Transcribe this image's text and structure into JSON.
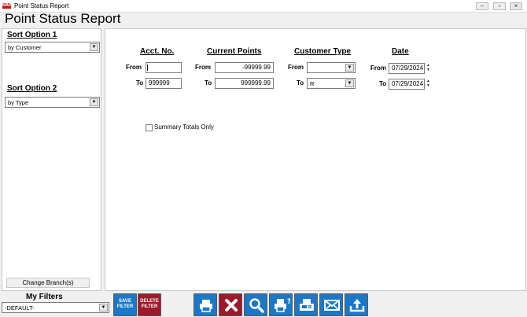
{
  "window": {
    "title": "Point Status Report",
    "app_icon_text": "HAP",
    "controls": [
      "minimize",
      "restore",
      "close"
    ]
  },
  "report": {
    "title": "Point Status Report"
  },
  "sort": {
    "option1_label": "Sort Option 1",
    "option1_value": "by Customer",
    "option2_label": "Sort Option 2",
    "option2_value": "by Type",
    "change_branch_label": "Change Branch(s)"
  },
  "criteria": {
    "acct": {
      "heading": "Acct. No.",
      "from_label": "From",
      "to_label": "To",
      "from_value": "",
      "to_value": "999999"
    },
    "points": {
      "heading": "Current Points",
      "from_label": "From",
      "to_label": "To",
      "from_value": "-99999.99",
      "to_value": "999999.99"
    },
    "customer_type": {
      "heading": "Customer Type",
      "from_label": "From",
      "to_label": "To",
      "from_value": "",
      "to_value": "R"
    },
    "date": {
      "heading": "Date",
      "from_label": "From",
      "to_label": "To",
      "from_value": "07/29/2024",
      "to_value": "07/29/2024"
    },
    "summary_only_label": "Summary Totals Only",
    "summary_only_checked": false
  },
  "filters": {
    "title": "My Filters",
    "selected": "-DEFAULT-",
    "save_label_line1": "SAVE",
    "save_label_line2": "FILTER",
    "delete_label_line1": "DELETE",
    "delete_label_line2": "FILTER"
  },
  "toolbar": {
    "icons": [
      "printer-icon",
      "close-icon",
      "search-icon",
      "print-preview-icon",
      "fax-icon",
      "email-icon",
      "upload-icon"
    ]
  },
  "colors": {
    "button_blue": "#1b78c8",
    "button_red": "#9c1a2a",
    "panel_bg": "#ffffff",
    "window_bg": "#f0f0f0"
  }
}
